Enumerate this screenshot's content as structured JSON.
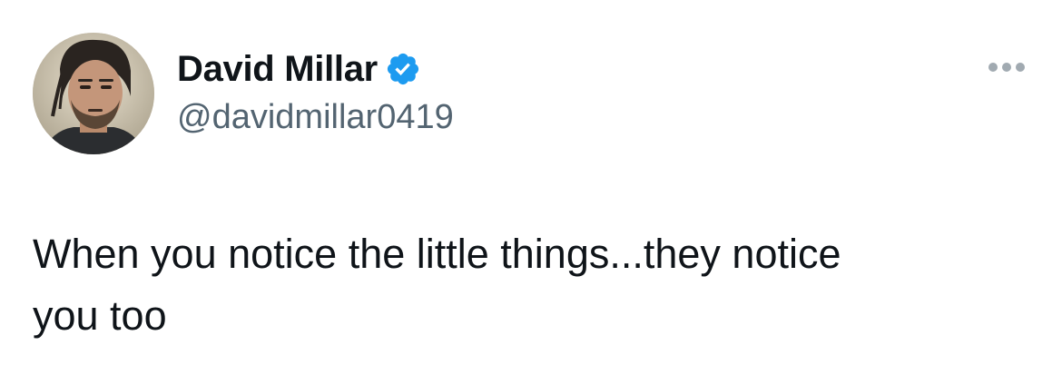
{
  "author": {
    "display_name": "David Millar",
    "handle": "@davidmillar0419",
    "verified": true,
    "verified_icon": "verified-badge-icon",
    "avatar_icon": "avatar"
  },
  "menu": {
    "icon": "more-horizontal-icon"
  },
  "tweet": {
    "text": "When you notice the little things...they notice\nyou too"
  },
  "colors": {
    "text_primary": "#0f1419",
    "text_secondary": "#536471",
    "verified_blue": "#1d9bf0",
    "background": "#ffffff"
  }
}
